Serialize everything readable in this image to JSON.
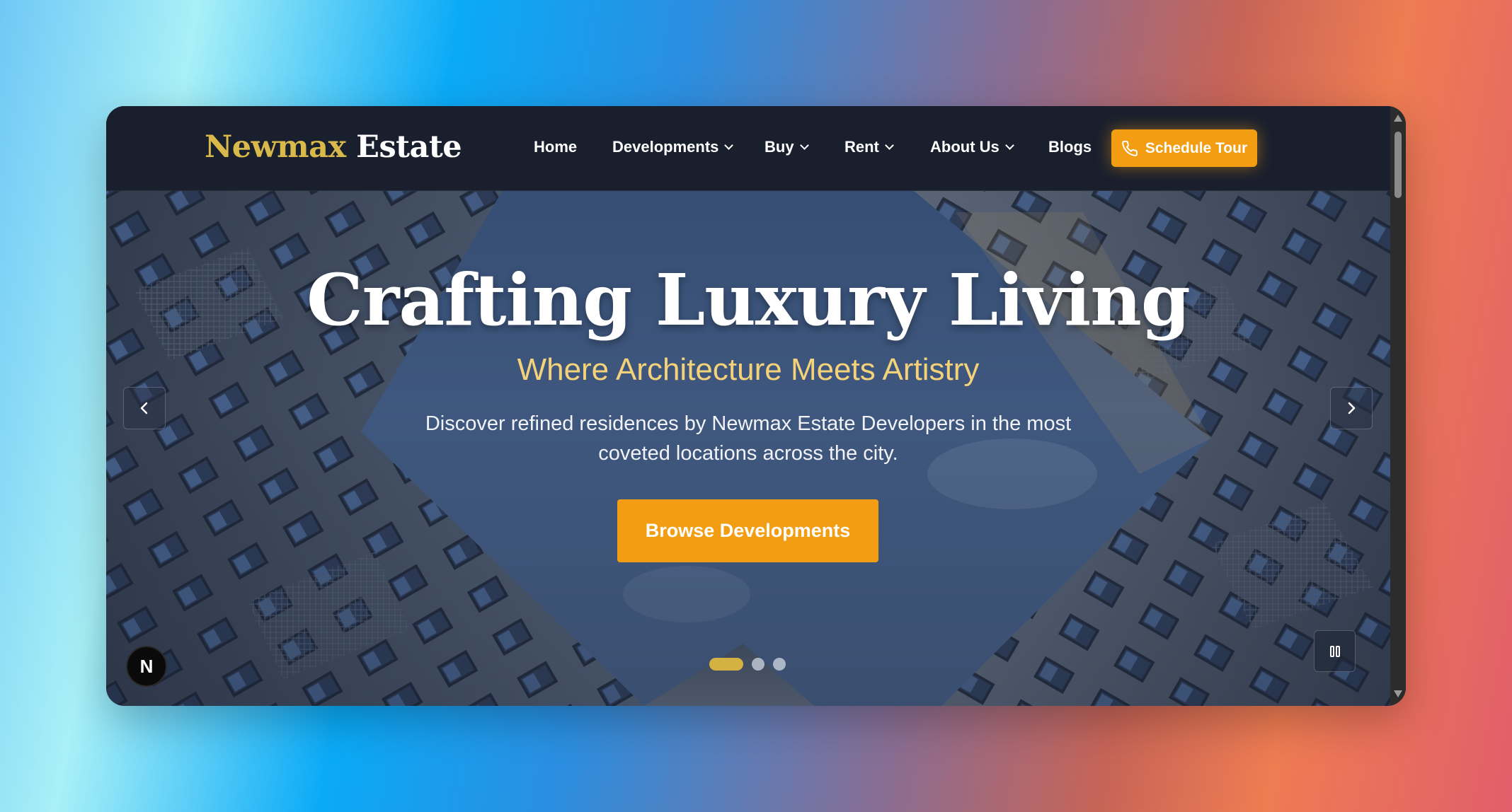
{
  "nav": {
    "logo_part1": "Newmax",
    "logo_part2": "Estate",
    "items": [
      {
        "label": "Home",
        "dropdown": false
      },
      {
        "label": "Developments",
        "dropdown": true
      },
      {
        "label": "Buy",
        "dropdown": true
      },
      {
        "label": "Rent",
        "dropdown": true
      },
      {
        "label": "About Us",
        "dropdown": true
      },
      {
        "label": "Blogs",
        "dropdown": false
      }
    ],
    "cta_label": "Schedule Tour",
    "cta_icon": "phone-icon"
  },
  "hero": {
    "title": "Crafting Luxury Living",
    "subtitle": "Where Architecture Meets Artistry",
    "description_line1": "Discover refined residences by Newmax Estate Developers in the most",
    "description_line2": "coveted locations across the city.",
    "button_label": "Browse Developments",
    "slides_total": 3,
    "active_slide": 1
  },
  "badge_letter": "N",
  "colors": {
    "accent": "#f29d12",
    "gold": "#d9b94a",
    "subtitle": "#f3d27a",
    "navbar": "#181c28"
  }
}
